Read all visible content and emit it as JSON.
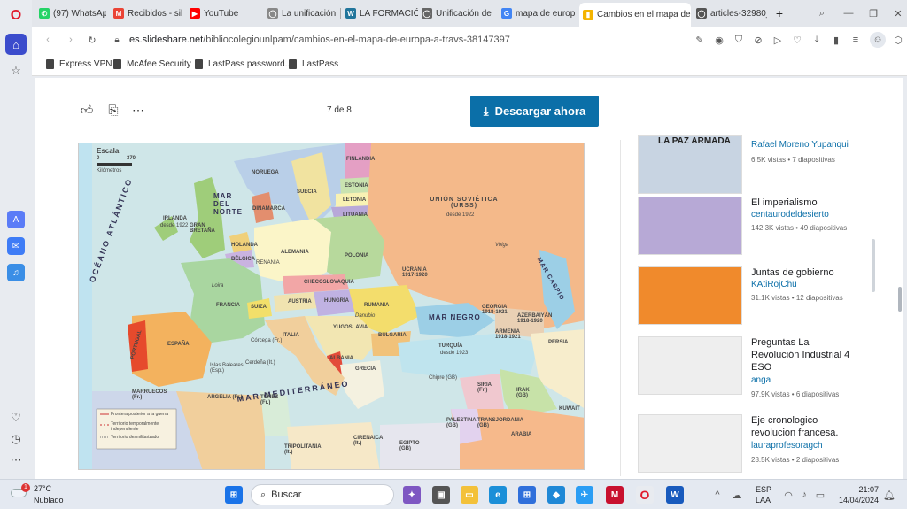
{
  "tabs": [
    {
      "label": "(97) WhatsApp",
      "color": "#25d366",
      "glyph": "✆"
    },
    {
      "label": "Recibidos - silvi",
      "color": "#ea4335",
      "glyph": "M"
    },
    {
      "label": "YouTube",
      "color": "#ff0000",
      "glyph": "▶"
    },
    {
      "label": "La unificación a",
      "color": "#777777",
      "glyph": "◯"
    },
    {
      "label": "LA FORMACIÓN",
      "color": "#21759b",
      "glyph": "W"
    },
    {
      "label": "Unificación de I",
      "color": "#555555",
      "glyph": "◯"
    },
    {
      "label": "mapa de europ",
      "color": "#4285f4",
      "glyph": "G"
    },
    {
      "label": "Cambios en el mapa de e",
      "color": "#f4b400",
      "glyph": "▮"
    },
    {
      "label": "articles-32980_",
      "color": "#555555",
      "glyph": "◯"
    }
  ],
  "address": {
    "domain": "es.slideshare.net",
    "path": "/bibliocolegiounlpam/cambios-en-el-mapa-de-europa-a-travs-38147397"
  },
  "bookmarks": [
    "Express VPN",
    "McAfee Security",
    "LastPass password...",
    "LastPass"
  ],
  "viewer": {
    "page_counter": "7 de 8",
    "download_label": "Descargar ahora"
  },
  "map": {
    "scale_title": "Escala",
    "scale_min": "0",
    "scale_max": "370",
    "scale_unit": "Kilómetros",
    "ocean_atl": "OCÉANO ATLÁNTICO",
    "mar_norte": "MAR DEL NORTE",
    "mar_med": "MAR MEDITERRÁNEO",
    "mar_negro": "MAR NEGRO",
    "mar_caspio": "MAR CASPIO",
    "legend": [
      "Frontera posterior a la guerra",
      "Territorio temporalmente independiente",
      "Territorio desmilitarizado"
    ],
    "countries": {
      "noruega": "NORUEGA",
      "finlandia": "FINLANDIA",
      "suecia": "SUECIA",
      "estonia": "ESTONIA",
      "letonia": "LETONIA",
      "lituania": "LITUANIA",
      "dinamarca": "DINAMARCA",
      "irlanda": "IRLANDA",
      "irlanda_sub": "desde 1922",
      "gran_bretana": "GRAN BRETAÑA",
      "holanda": "HOLANDA",
      "belgica": "BÉLGICA",
      "alemania": "ALEMANIA",
      "polonia": "POLONIA",
      "urss": "UNIÓN SOVIÉTICA (URSS)",
      "urss_sub": "desde 1922",
      "ucrania": "UCRANIA 1917-1920",
      "francia": "FRANCIA",
      "suiza": "SUIZA",
      "austria": "AUSTRIA",
      "hungria": "HUNGRÍA",
      "checo": "CHECOSLOVAQUIA",
      "rumania": "RUMANIA",
      "yugoslavia": "YUGOSLAVIA",
      "bulgaria": "BULGARIA",
      "italia": "ITALIA",
      "albania": "ALBANIA",
      "grecia": "GRECIA",
      "espana": "ESPAÑA",
      "portugal": "PORTUGAL",
      "turquia": "TURQUÍA",
      "turquia_sub": "desde 1923",
      "georgia": "GEORGIA 1918-1921",
      "azerbaiyan": "AZERBAIYÁN 1918-1920",
      "armenia": "ARMENIA 1918-1921",
      "persia": "PERSIA",
      "siria": "SIRIA (Fr.)",
      "irak": "IRAK (GB)",
      "kuwait": "KUWAIT",
      "arabia": "ARABIA",
      "transjordania": "TRANSJORDANIA (GB)",
      "palestina": "PALESTINA (GB)",
      "egipto": "EGIPTO (GB)",
      "marruecos": "MARRUECOS (Fr.)",
      "argelia": "ARGELIA (Fr.)",
      "tunez": "TÚNEZ (Fr.)",
      "tripolitania": "TRIPOLITANIA (It.)",
      "cirenaica": "CIRENAICA (It.)",
      "renania": "RENANIA",
      "corcega": "Córcega (Fr.)",
      "cerdena": "Cerdeña (It.)",
      "chipre": "Chipre (GB)",
      "baleares": "Islas Baleares (Esp.)",
      "volga": "Volga",
      "loira": "Loira",
      "danubio": "Danubio"
    }
  },
  "related": [
    {
      "title": "LA PAZ ARMADA",
      "author": "Rafael Moreno Yupanqui",
      "views": "6.5K vistas",
      "slides": "7 diapositivas",
      "thumb": "#c8d4e2"
    },
    {
      "title": "El imperialismo",
      "author": "centaurodeldesierto",
      "views": "142.3K vistas",
      "slides": "49 diapositivas",
      "thumb": "#b7a9d6"
    },
    {
      "title": "Juntas de gobierno",
      "author": "KAtiRojChu",
      "views": "31.1K vistas",
      "slides": "12 diapositivas",
      "thumb": "#f08a2c"
    },
    {
      "title": "Preguntas La Revolución Industrial 4 ESO",
      "author": "anga",
      "views": "97.9K vistas",
      "slides": "6 diapositivas",
      "thumb": "#eeeeee"
    },
    {
      "title": "Eje cronologico revolucion francesa.",
      "author": "lauraprofesoragch",
      "views": "28.5K vistas",
      "slides": "2 diapositivas",
      "thumb": "#efefef"
    }
  ],
  "taskbar": {
    "weather_temp": "27°C",
    "weather_desc": "Nublado",
    "weather_badge": "1",
    "search_placeholder": "Buscar",
    "lang": "ESP",
    "lang2": "LAA",
    "time": "21:07",
    "date": "14/04/2024"
  }
}
